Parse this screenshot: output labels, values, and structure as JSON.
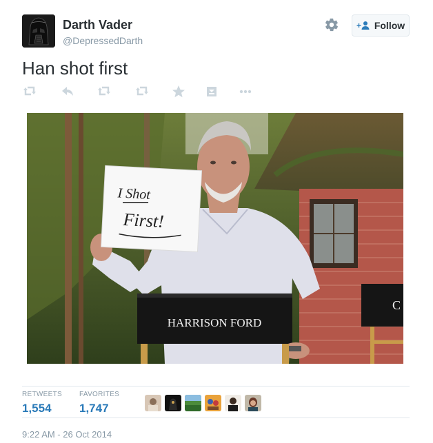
{
  "user": {
    "name": "Darth Vader",
    "handle": "@DepressedDarth"
  },
  "follow_button": {
    "label": "Follow"
  },
  "tweet": {
    "text": "Han shot first"
  },
  "actions": [
    "retweet-icon",
    "reply-icon",
    "retweet-icon",
    "retweet-icon",
    "star-icon",
    "embed-icon",
    "more-icon"
  ],
  "media": {
    "sign_text_line1": "I Shot",
    "sign_text_line2": "First!",
    "chair_text": "HARRISON FORD",
    "chair2_text": "C"
  },
  "stats": {
    "retweets_label": "RETWEETS",
    "retweets_value": "1,554",
    "favorites_label": "FAVORITES",
    "favorites_value": "1,747"
  },
  "timestamp": "9:22 AM - 26 Oct 2014",
  "colors": {
    "link": "#2b7bb9",
    "muted": "#8899a6",
    "text": "#292f33",
    "border": "#e1e8ed"
  }
}
